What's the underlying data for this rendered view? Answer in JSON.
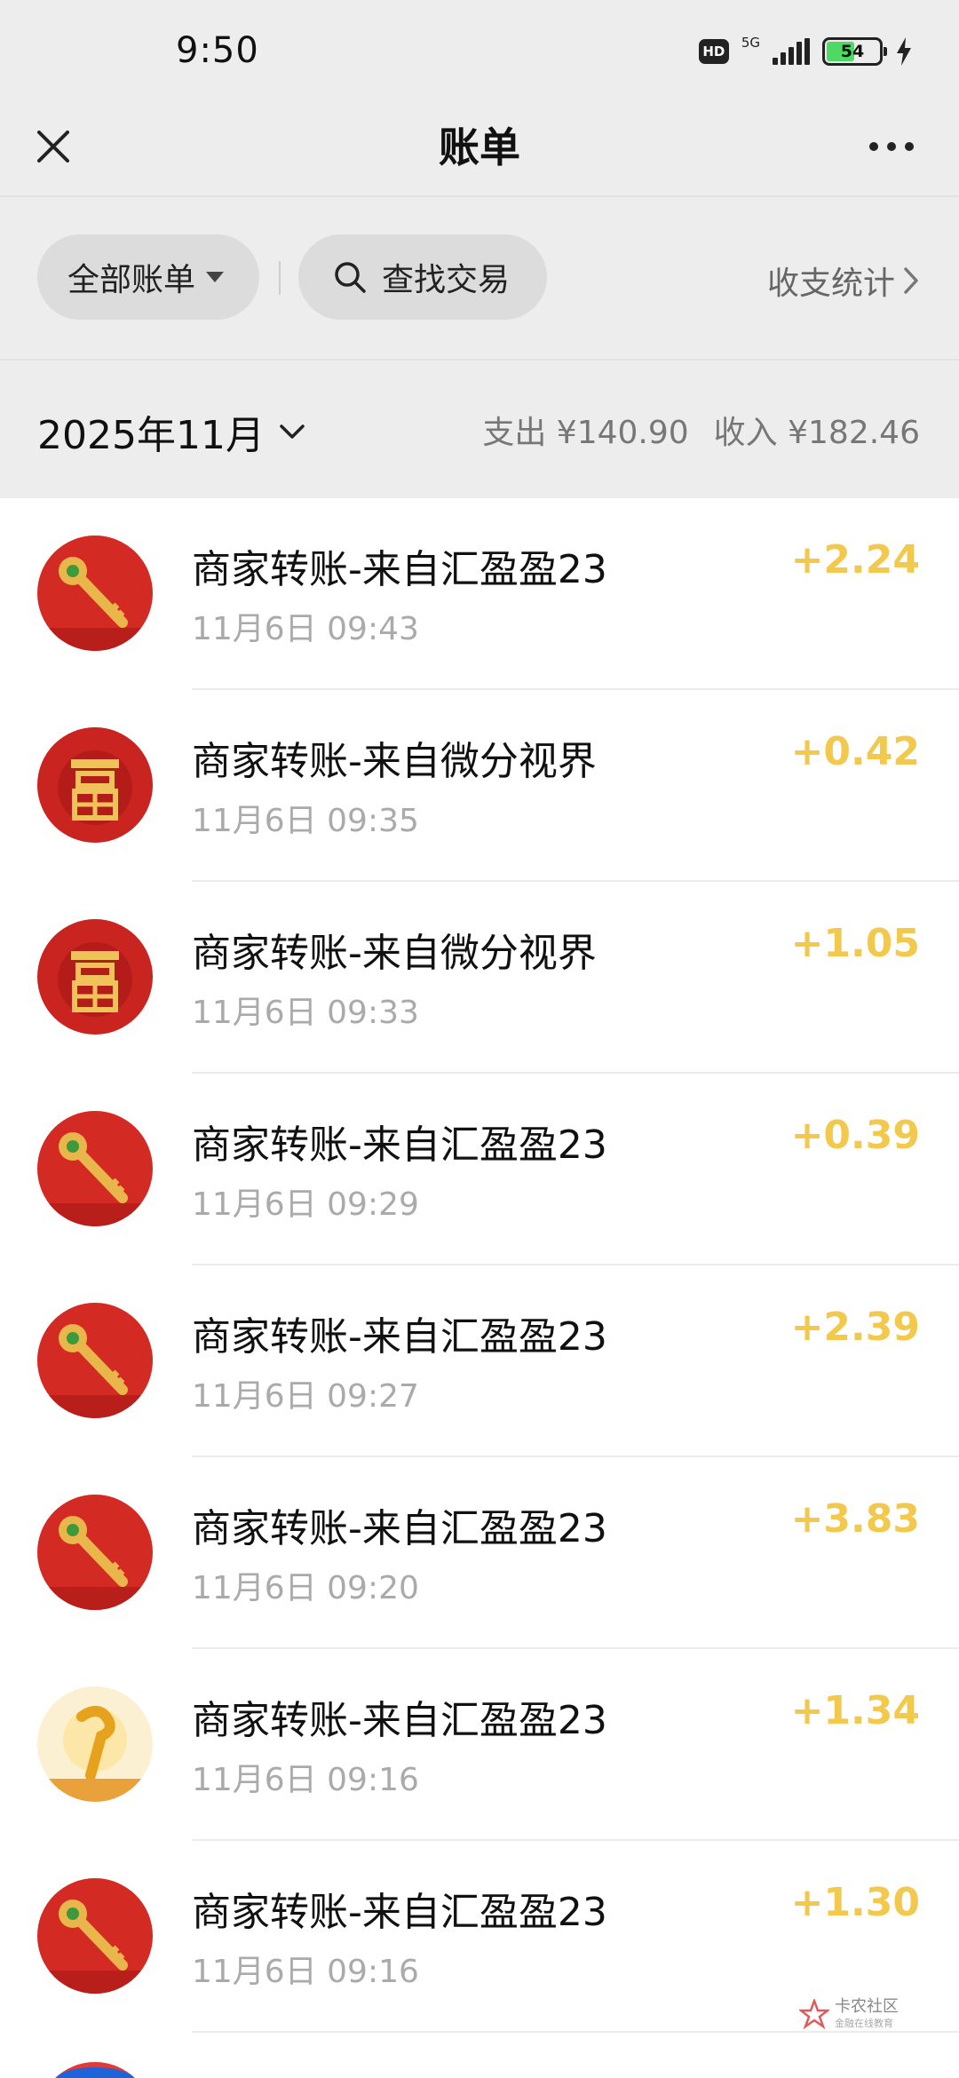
{
  "status_bar": {
    "time": "9:50",
    "hd_label": "HD",
    "network_label": "5G",
    "battery_percent": "54"
  },
  "nav": {
    "title": "账单"
  },
  "filters": {
    "all_bills_label": "全部账单",
    "search_label": "查找交易",
    "stats_label": "收支统计"
  },
  "month_summary": {
    "month_label": "2025年11月",
    "expense_text": "支出 ¥140.90",
    "income_text": "收入 ¥182.46"
  },
  "transactions": [
    {
      "title": "商家转账-来自汇盈盈23",
      "time": "11月6日 09:43",
      "amount": "+2.24",
      "avatar": "key-red-avatar-icon"
    },
    {
      "title": "商家转账-来自微分视界",
      "time": "11月6日 09:35",
      "amount": "+0.42",
      "avatar": "fu-character-avatar-icon"
    },
    {
      "title": "商家转账-来自微分视界",
      "time": "11月6日 09:33",
      "amount": "+1.05",
      "avatar": "fu-character-avatar-icon"
    },
    {
      "title": "商家转账-来自汇盈盈23",
      "time": "11月6日 09:29",
      "amount": "+0.39",
      "avatar": "key-red-avatar-icon"
    },
    {
      "title": "商家转账-来自汇盈盈23",
      "time": "11月6日 09:27",
      "amount": "+2.39",
      "avatar": "key-red-avatar-icon"
    },
    {
      "title": "商家转账-来自汇盈盈23",
      "time": "11月6日 09:20",
      "amount": "+3.83",
      "avatar": "key-red-avatar-icon"
    },
    {
      "title": "商家转账-来自汇盈盈23",
      "time": "11月6日 09:16",
      "amount": "+1.34",
      "avatar": "ruyi-light-avatar-icon"
    },
    {
      "title": "商家转账-来自汇盈盈23",
      "time": "11月6日 09:16",
      "amount": "+1.30",
      "avatar": "key-red-avatar-icon"
    }
  ],
  "watermark": {
    "title": "卡农社区",
    "subtitle": "金融在线教育"
  },
  "colors": {
    "amount": "#f2c94c",
    "background": "#ededed",
    "list_background": "#ffffff"
  }
}
